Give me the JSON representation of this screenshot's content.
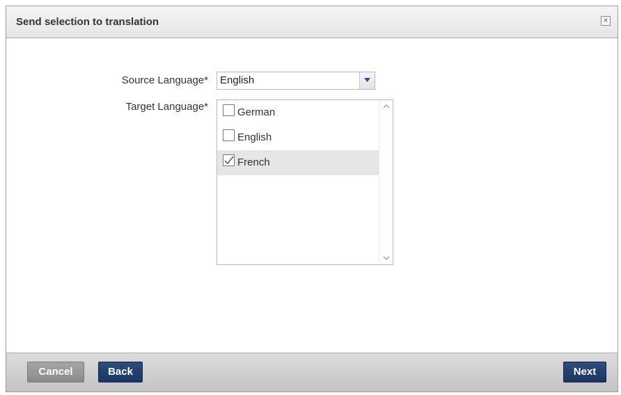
{
  "dialog": {
    "title": "Send selection to translation",
    "close_icon": "close-icon"
  },
  "form": {
    "source_label": "Source Language*",
    "source_value": "English",
    "target_label": "Target Language*",
    "target_options": [
      {
        "label": "German",
        "checked": false
      },
      {
        "label": "English",
        "checked": false
      },
      {
        "label": "French",
        "checked": true
      }
    ]
  },
  "footer": {
    "cancel_label": "Cancel",
    "back_label": "Back",
    "next_label": "Next"
  },
  "colors": {
    "primary_button": "#1b3560",
    "disabled_button": "#8a8a8a",
    "selected_row": "#e6e6e6"
  }
}
